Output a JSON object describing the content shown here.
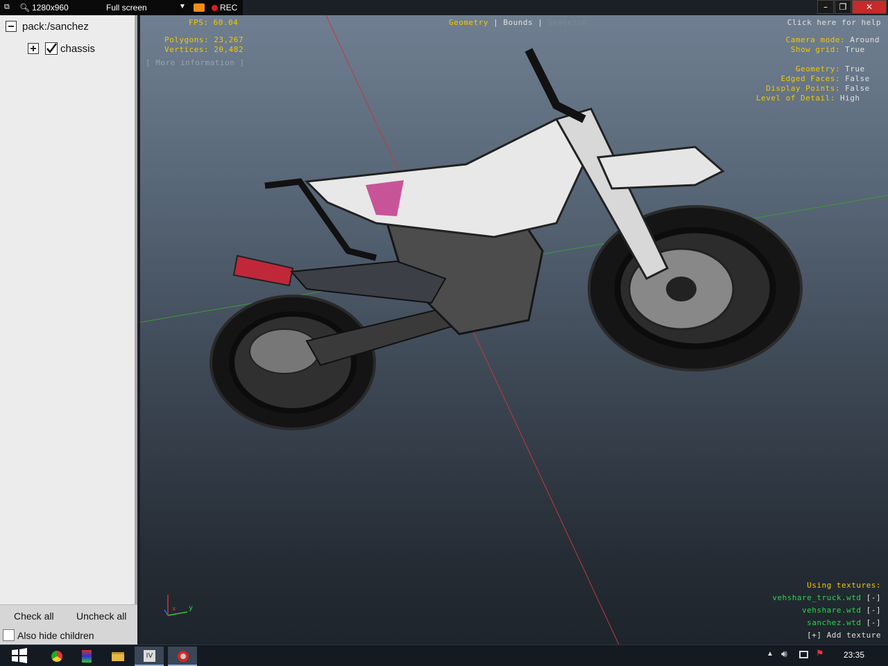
{
  "recorder": {
    "resolution": "1280x960",
    "mode": "Full screen",
    "rec": "REC"
  },
  "tree": {
    "root": "pack:/sanchez",
    "child": "chassis"
  },
  "panel": {
    "check_all": "Check all",
    "uncheck_all": "Uncheck all",
    "also_hide_children": "Also hide children"
  },
  "viewport": {
    "fps_label": "FPS:",
    "fps": "60.04",
    "polygons_label": "Polygons:",
    "polygons": "23,267",
    "vertices_label": "Vertices:",
    "vertices": "20,482",
    "more_info": "[ More information ]",
    "modes": [
      "Geometry",
      "Bounds",
      "Skeleton"
    ],
    "help": "Click here for help",
    "camera_mode_label": "Camera mode:",
    "camera_mode": "Around",
    "show_grid_label": "Show grid:",
    "show_grid": "True",
    "geometry_label": "Geometry:",
    "geometry": "True",
    "edged_faces_label": "Edged Faces:",
    "edged_faces": "False",
    "display_points_label": "Display Points:",
    "display_points": "False",
    "lod_label": "Level of Detail:",
    "lod": "High",
    "using_textures": "Using textures:",
    "textures": [
      "vehshare_truck.wtd",
      "vehshare.wtd",
      "sanchez.wtd"
    ],
    "remove": "[-]",
    "add_texture": "[+] Add texture",
    "axes": {
      "x": "x",
      "y": "y"
    }
  },
  "taskbar": {
    "time": "23:35"
  },
  "colors": {
    "accent_yellow": "#f0c800",
    "texture_green": "#2ad64a"
  }
}
